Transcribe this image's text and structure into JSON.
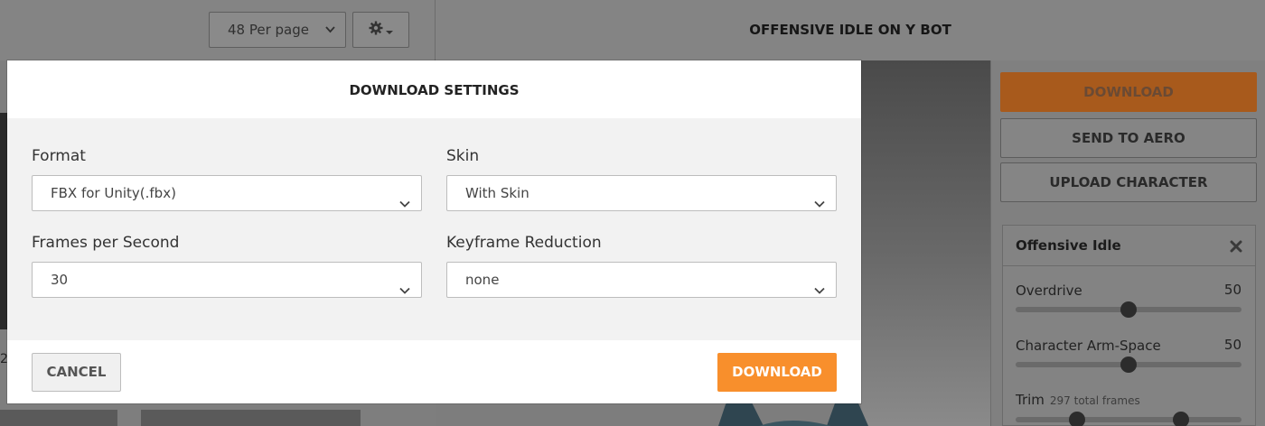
{
  "toolbar": {
    "per_page": "48 Per page",
    "settings_icon": "gear-icon",
    "settings_chevron_icon": "caret-down-icon"
  },
  "animation": {
    "title": "OFFENSIVE IDLE ON Y BOT"
  },
  "side_panel": {
    "download_label": "DOWNLOAD",
    "send_to_aero_label": "SEND TO AERO",
    "upload_character_label": "UPLOAD CHARACTER",
    "card": {
      "title": "Offensive Idle",
      "close_icon": "close-icon",
      "sliders": [
        {
          "label": "Overdrive",
          "value": "50",
          "fraction": 0.5
        },
        {
          "label": "Character Arm-Space",
          "value": "50",
          "fraction": 0.5
        },
        {
          "label": "Trim",
          "sub": "297 total frames",
          "range": [
            0.27,
            0.73
          ]
        }
      ]
    }
  },
  "background": {
    "partial_number": "2"
  },
  "modal": {
    "title": "DOWNLOAD SETTINGS",
    "fields": {
      "format": {
        "label": "Format",
        "value": "FBX for Unity(.fbx)"
      },
      "skin": {
        "label": "Skin",
        "value": "With Skin"
      },
      "fps": {
        "label": "Frames per Second",
        "value": "30"
      },
      "keyframe": {
        "label": "Keyframe Reduction",
        "value": "none"
      }
    },
    "cancel_label": "CANCEL",
    "download_label": "DOWNLOAD",
    "colors": {
      "accent": "#f88f2c"
    }
  }
}
